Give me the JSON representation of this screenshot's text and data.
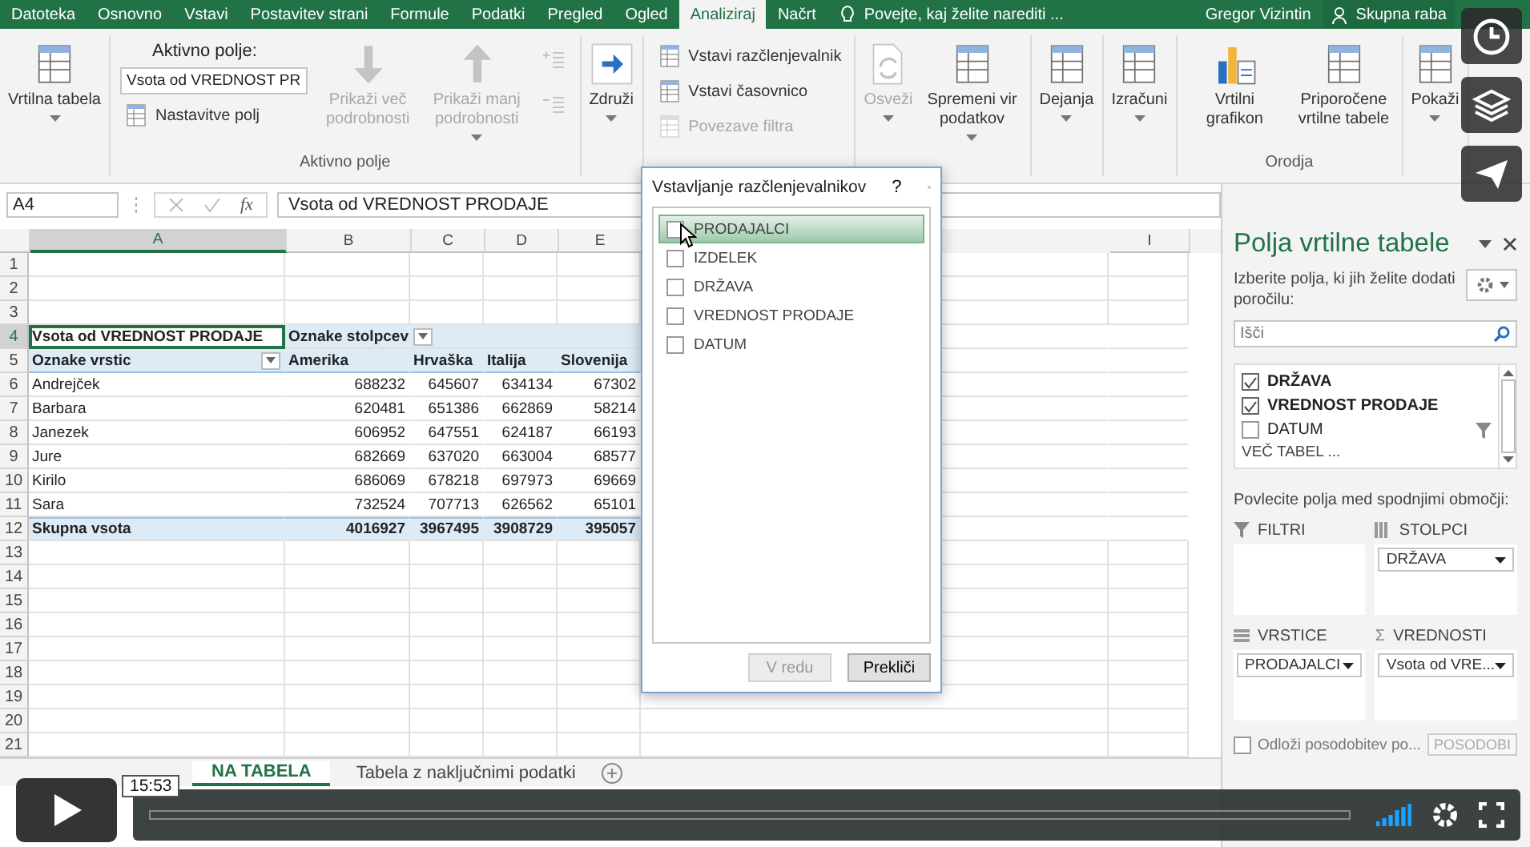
{
  "ribbon_tabs": [
    {
      "label": "Datoteka",
      "selected": false
    },
    {
      "label": "Osnovno",
      "selected": false
    },
    {
      "label": "Vstavi",
      "selected": false
    },
    {
      "label": "Postavitev strani",
      "selected": false
    },
    {
      "label": "Formule",
      "selected": false
    },
    {
      "label": "Podatki",
      "selected": false
    },
    {
      "label": "Pregled",
      "selected": false
    },
    {
      "label": "Ogled",
      "selected": false
    },
    {
      "label": "Analiziraj",
      "selected": true
    },
    {
      "label": "Načrt",
      "selected": false
    }
  ],
  "tell_me": "Povejte, kaj želite narediti ...",
  "user": "Gregor Vizintin",
  "share": "Skupna raba",
  "ribbon_groups": [
    {
      "items": [
        {
          "kind": "large",
          "label": "Vrtilna tabela",
          "dropdown": true,
          "disabled": false
        }
      ]
    },
    {
      "label": "Aktivno polje",
      "items": [
        {
          "kind": "field",
          "label": "Aktivno polje:",
          "value": "Vsota od VREDNOST PR"
        },
        {
          "kind": "small",
          "label": "Nastavitve polj",
          "disabled": false
        },
        {
          "kind": "large",
          "label": "Prikaži več podrobnosti",
          "dropdown": false,
          "disabled": true
        },
        {
          "kind": "large",
          "label": "Prikaži manj podrobnosti",
          "dropdown": true,
          "disabled": true
        },
        {
          "kind": "icon",
          "disabled": true
        },
        {
          "kind": "icon",
          "disabled": true
        }
      ]
    },
    {
      "items": [
        {
          "kind": "large",
          "label": "Združi",
          "dropdown": true,
          "disabled": false
        }
      ]
    },
    {
      "items": [
        {
          "kind": "small",
          "label": "Vstavi razčlenjevalnik",
          "disabled": false
        },
        {
          "kind": "small",
          "label": "Vstavi časovnico",
          "disabled": false
        },
        {
          "kind": "small",
          "label": "Povezave filtra",
          "disabled": true
        }
      ]
    },
    {
      "items": [
        {
          "kind": "large",
          "label": "Osveži",
          "dropdown": true,
          "disabled": true
        },
        {
          "kind": "large",
          "label": "Spremeni vir podatkov",
          "dropdown": true,
          "disabled": false
        }
      ]
    },
    {
      "items": [
        {
          "kind": "large",
          "label": "Dejanja",
          "dropdown": true,
          "disabled": false
        }
      ]
    },
    {
      "items": [
        {
          "kind": "large",
          "label": "Izračuni",
          "dropdown": true,
          "disabled": false
        }
      ]
    },
    {
      "label": "Orodja",
      "items": [
        {
          "kind": "large",
          "label": "Vrtilni grafikon",
          "dropdown": false,
          "disabled": false
        },
        {
          "kind": "large",
          "label": "Priporočene vrtilne tabele",
          "dropdown": false,
          "disabled": false
        }
      ]
    },
    {
      "items": [
        {
          "kind": "large",
          "label": "Pokaži",
          "dropdown": true,
          "disabled": false
        }
      ]
    }
  ],
  "formula_bar": {
    "name_box": "A4",
    "function_label": "fx",
    "formula": "Vsota od VREDNOST PRODAJE"
  },
  "columns": [
    "A",
    "B",
    "C",
    "D",
    "E",
    "I"
  ],
  "rows": [
    {
      "number": "1",
      "kind": "blank"
    },
    {
      "number": "2",
      "kind": "blank"
    },
    {
      "number": "3",
      "kind": "blank"
    },
    {
      "number": "4",
      "kind": "pivot_header",
      "cells": [
        {
          "text": "Vsota od VREDNOST PRODAJE",
          "filter": false,
          "selected": true
        },
        {
          "text": "Oznake stolpcev",
          "filter": true,
          "selected": false
        }
      ]
    },
    {
      "number": "5",
      "kind": "pivot_labels",
      "cells": [
        {
          "text": "Oznake vrstic",
          "filter": true,
          "selected": false
        },
        {
          "text": "Amerika",
          "filter": false,
          "selected": false
        },
        {
          "text": "Hrvaška",
          "filter": false,
          "selected": false
        },
        {
          "text": "Italija",
          "filter": false,
          "selected": false
        },
        {
          "text": "Slovenija",
          "filter": false,
          "selected": false
        }
      ]
    },
    {
      "number": "6",
      "kind": "data",
      "cells": [
        "Andrejček",
        "688232",
        "645607",
        "634134",
        "67302"
      ]
    },
    {
      "number": "7",
      "kind": "data",
      "cells": [
        "Barbara",
        "620481",
        "651386",
        "662869",
        "58214"
      ]
    },
    {
      "number": "8",
      "kind": "data",
      "cells": [
        "Janezek",
        "606952",
        "647551",
        "624187",
        "66193"
      ]
    },
    {
      "number": "9",
      "kind": "data",
      "cells": [
        "Jure",
        "682669",
        "637020",
        "663004",
        "68577"
      ]
    },
    {
      "number": "10",
      "kind": "data",
      "cells": [
        "Kirilo",
        "686069",
        "678218",
        "697973",
        "69669"
      ]
    },
    {
      "number": "11",
      "kind": "data",
      "cells": [
        "Sara",
        "732524",
        "707713",
        "626562",
        "65101"
      ]
    },
    {
      "number": "12",
      "kind": "total",
      "cells": [
        "Skupna vsota",
        "4016927",
        "3967495",
        "3908729",
        "395057"
      ]
    },
    {
      "number": "13",
      "kind": "blank"
    },
    {
      "number": "14",
      "kind": "blank"
    },
    {
      "number": "15",
      "kind": "blank"
    },
    {
      "number": "16",
      "kind": "blank"
    },
    {
      "number": "17",
      "kind": "blank"
    },
    {
      "number": "18",
      "kind": "blank"
    },
    {
      "number": "19",
      "kind": "blank"
    },
    {
      "number": "20",
      "kind": "blank"
    },
    {
      "number": "21",
      "kind": "blank"
    }
  ],
  "sheet_tabs": [
    {
      "label": "NA TABELA",
      "selected": true
    },
    {
      "label": "Tabela z naključnimi podatki",
      "selected": false
    }
  ],
  "dialog": {
    "title": "Vstavljanje razčlenjevalnikov",
    "help": "?",
    "items": [
      {
        "label": "PRODAJALCI",
        "checked": false,
        "hovered": true
      },
      {
        "label": "IZDELEK",
        "checked": false,
        "hovered": false
      },
      {
        "label": "DRŽAVA",
        "checked": false,
        "hovered": false
      },
      {
        "label": "VREDNOST PRODAJE",
        "checked": false,
        "hovered": false
      },
      {
        "label": "DATUM",
        "checked": false,
        "hovered": false
      }
    ],
    "buttons": [
      {
        "label": "V redu",
        "disabled": true
      },
      {
        "label": "Prekliči",
        "disabled": false
      }
    ]
  },
  "pane": {
    "title": "Polja vrtilne tabele",
    "subtitle": "Izberite polja, ki jih želite dodati poročilu:",
    "search": {
      "placeholder": "Išči"
    },
    "fields": [
      {
        "label": "DRŽAVA",
        "checked": true,
        "filter": false
      },
      {
        "label": "VREDNOST PRODAJE",
        "checked": true,
        "filter": false
      },
      {
        "label": "DATUM",
        "checked": false,
        "filter": true
      }
    ],
    "more_tables": "VEČ TABEL ...",
    "hint": "Povlecite polja med spodnjimi območji:",
    "areas": [
      {
        "kind": "filters",
        "label": "FILTRI"
      },
      {
        "kind": "columns",
        "label": "STOLPCI",
        "items": [
          "DRŽAVA"
        ]
      },
      {
        "kind": "rows",
        "label": "VRSTICE",
        "items": [
          "PRODAJALCI"
        ]
      },
      {
        "kind": "values",
        "symbol": "Σ",
        "label": "VREDNOSTI",
        "items": [
          "Vsota od VRE..."
        ]
      }
    ],
    "defer": {
      "label": "Odloži posodobitev po...",
      "checked": false
    },
    "update_button": {
      "label": "POSODOBI",
      "disabled": true
    }
  },
  "player": {
    "time": "15:53"
  }
}
